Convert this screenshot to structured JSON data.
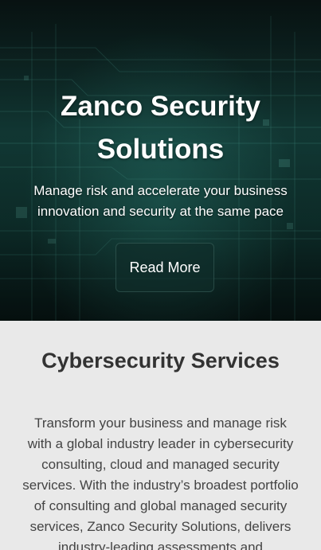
{
  "hero": {
    "title": "Zanco Security Solutions",
    "subtitle": "Manage risk and accelerate your business innovation and security at the same pace",
    "button_label": "Read More",
    "background_image": "circuit-board"
  },
  "services": {
    "title": "Cybersecurity Services",
    "body": "Transform your business and manage risk with a global industry leader in cybersecurity consulting, cloud and managed security services. With the industry’s broadest portfolio of consulting and global managed security services, Zanco Security Solutions, delivers industry-leading assessments and"
  },
  "colors": {
    "hero_dark": "#0c1c1b",
    "hero_teal": "#1e5a52",
    "section_bg": "#e9e9e9",
    "heading_text": "#333333",
    "body_text": "#444444"
  }
}
